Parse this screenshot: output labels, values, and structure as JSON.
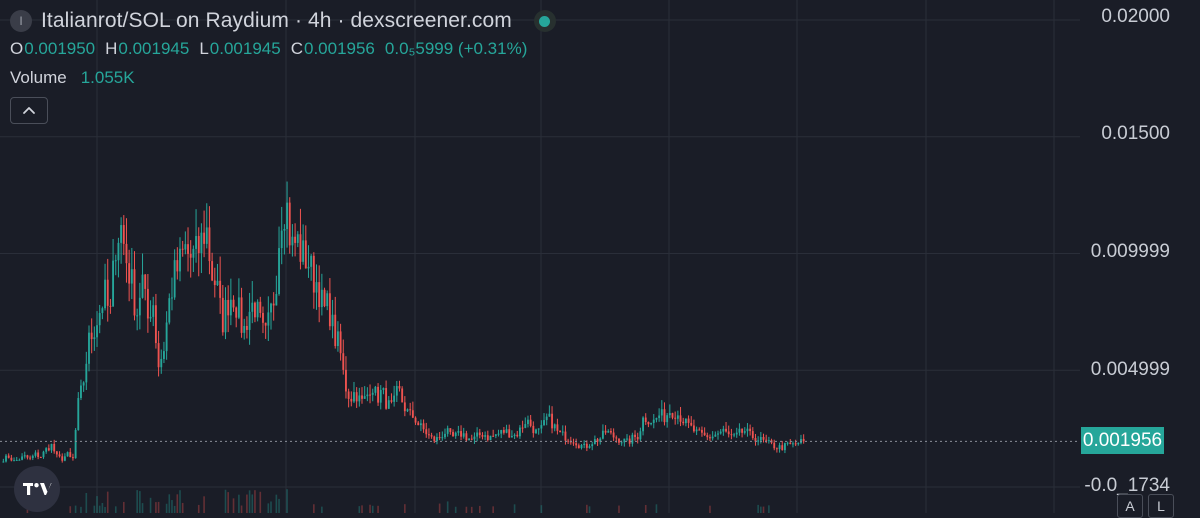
{
  "header": {
    "symbol_initial": "I",
    "title": "Italianrot/SOL on Raydium · 4h · dexscreener.com",
    "status_color": "#26a69a"
  },
  "ohlc": {
    "open_label": "O",
    "open": "0.001950",
    "high_label": "H",
    "high": "0.001945",
    "low_label": "L",
    "low": "0.001945",
    "close_label": "C",
    "close": "0.001956",
    "change": "0.0₅5999 (+0.31%)"
  },
  "volume": {
    "label": "Volume",
    "value": "1.055K"
  },
  "price_axis": {
    "labels": [
      "0.02000",
      "0.01500",
      "0.009999",
      "0.004999",
      "-0.0_1734"
    ],
    "last_price": "0.001956"
  },
  "scale_buttons": {
    "auto": "A",
    "log": "L"
  },
  "colors": {
    "background": "#1a1d27",
    "grid": "#2a2e39",
    "up": "#26a69a",
    "down": "#ef5350"
  },
  "chart_data": {
    "type": "candlestick",
    "timeframe": "4h",
    "ylim": [
      -0.0005,
      0.0205
    ],
    "last_price": 0.001956,
    "close_series": [
      0.0012,
      0.0013,
      0.0011,
      0.0012,
      0.0013,
      0.0012,
      0.0014,
      0.0013,
      0.0016,
      0.0018,
      0.0013,
      0.0012,
      0.0014,
      0.0011,
      0.0035,
      0.0045,
      0.0062,
      0.0068,
      0.0075,
      0.0083,
      0.0072,
      0.0105,
      0.0112,
      0.0098,
      0.0088,
      0.0074,
      0.009,
      0.0071,
      0.0082,
      0.0052,
      0.0058,
      0.0078,
      0.009,
      0.0095,
      0.0102,
      0.0098,
      0.0099,
      0.0104,
      0.0112,
      0.0092,
      0.0086,
      0.007,
      0.0079,
      0.0083,
      0.0076,
      0.0066,
      0.0075,
      0.0079,
      0.0071,
      0.0063,
      0.0073,
      0.0085,
      0.0118,
      0.0123,
      0.0102,
      0.0106,
      0.0099,
      0.0098,
      0.009,
      0.0087,
      0.0075,
      0.0078,
      0.0065,
      0.006,
      0.0044,
      0.0038,
      0.0041,
      0.0036,
      0.0038,
      0.0045,
      0.0038,
      0.0041,
      0.0035,
      0.0034,
      0.0042,
      0.0035,
      0.0031,
      0.003,
      0.0026,
      0.0024,
      0.0021,
      0.002,
      0.0022,
      0.0024,
      0.0021,
      0.0022,
      0.0023,
      0.0021,
      0.002,
      0.0022,
      0.0023,
      0.0021,
      0.0022,
      0.0023,
      0.0024,
      0.0023,
      0.0022,
      0.0025,
      0.0029,
      0.0026,
      0.0023,
      0.0025,
      0.003,
      0.0027,
      0.0023,
      0.0022,
      0.0021,
      0.002,
      0.0018,
      0.0017,
      0.0019,
      0.002,
      0.0021,
      0.0024,
      0.0022,
      0.0021,
      0.002,
      0.0019,
      0.0021,
      0.0022,
      0.003,
      0.0029,
      0.0028,
      0.0031,
      0.003,
      0.0033,
      0.0032,
      0.003,
      0.0027,
      0.0025,
      0.0023,
      0.0022,
      0.0021,
      0.0022,
      0.0023,
      0.0024,
      0.0022,
      0.0021,
      0.0023,
      0.0024,
      0.0022,
      0.0021,
      0.002,
      0.0019,
      0.0018,
      0.0017,
      0.0017,
      0.0018,
      0.0018,
      0.0019,
      0.001956
    ]
  }
}
